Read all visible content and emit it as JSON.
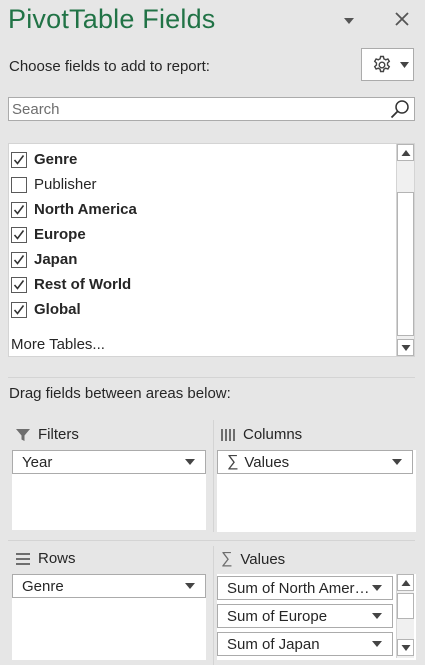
{
  "pane": {
    "title": "PivotTable Fields",
    "choose_label": "Choose fields to add to report:",
    "search_placeholder": "Search"
  },
  "fields": [
    {
      "label": "Genre",
      "checked": true
    },
    {
      "label": "Publisher",
      "checked": false
    },
    {
      "label": "North America",
      "checked": true
    },
    {
      "label": "Europe",
      "checked": true
    },
    {
      "label": "Japan",
      "checked": true
    },
    {
      "label": "Rest of World",
      "checked": true
    },
    {
      "label": "Global",
      "checked": true
    }
  ],
  "more_tables_label": "More Tables...",
  "drag_label": "Drag fields between areas below:",
  "areas": {
    "filters": {
      "title": "Filters",
      "items": [
        "Year"
      ]
    },
    "columns": {
      "title": "Columns",
      "items": [
        "Values"
      ]
    },
    "rows": {
      "title": "Rows",
      "items": [
        "Genre"
      ]
    },
    "values": {
      "title": "Values",
      "items": [
        "Sum of North America",
        "Sum of Europe",
        "Sum of Japan"
      ]
    }
  },
  "colors": {
    "accent": "#217346",
    "background": "#e6e6e6"
  }
}
